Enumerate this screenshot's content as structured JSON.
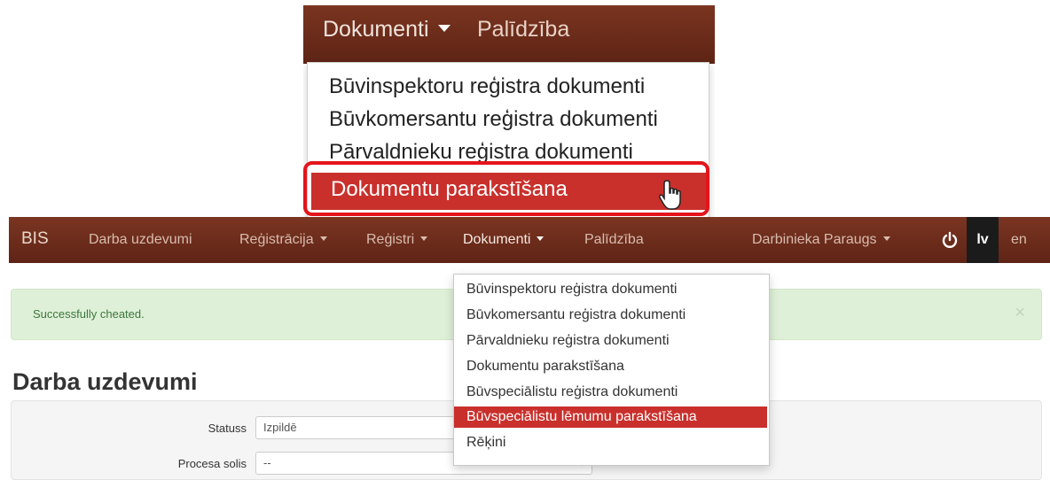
{
  "zoom": {
    "nav": {
      "dokumenti": "Dokumenti",
      "palidziba": "Palīdzība"
    },
    "menu": [
      "Būvinspektoru reģistra dokumenti",
      "Būvkomersantu reģistra dokumenti",
      "Pārvaldnieku reģistra dokumenti",
      "Dokumentu parakstīšana"
    ],
    "highlight_color": "#e5141b",
    "cursor_icon": "hand-pointer-icon"
  },
  "navbar": {
    "brand": "BIS",
    "items": [
      "Darba uzdevumi",
      "Reģistrācija",
      "Reģistri",
      "Dokumenti",
      "Palīdzība"
    ],
    "user": "Darbinieka Paraugs",
    "lang_active": "lv",
    "lang_other": "en",
    "bg_color": "#6e2d1c"
  },
  "dropdown": {
    "items": [
      "Būvinspektoru reģistra dokumenti",
      "Būvkomersantu reģistra dokumenti",
      "Pārvaldnieku reģistra dokumenti",
      "Dokumentu parakstīšana",
      "Būvspeciālistu reģistra dokumenti",
      "Būvspeciālistu lēmumu parakstīšana",
      "Rēķini"
    ],
    "active_index": 5,
    "active_color": "#c9302c"
  },
  "alert": {
    "message": "Successfully cheated.",
    "close": "×"
  },
  "page": {
    "title": "Darba uzdevumi"
  },
  "form": {
    "status_label": "Statuss",
    "status_value": "Izpildē",
    "process_label": "Procesa solis",
    "process_value": "--"
  }
}
